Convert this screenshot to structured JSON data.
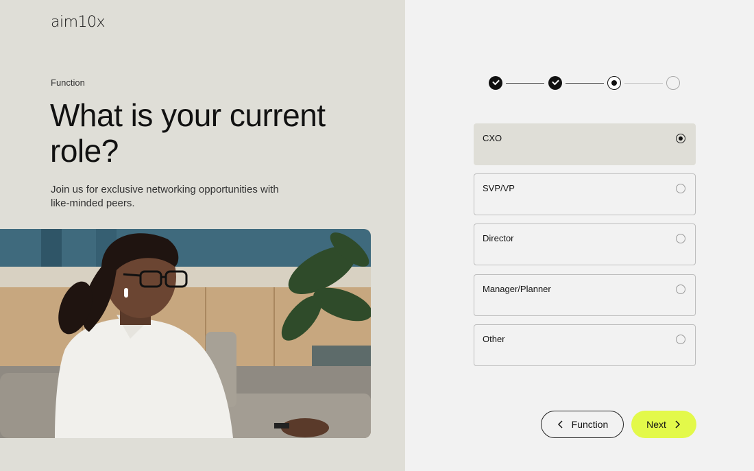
{
  "brand": {
    "logo": "aim10x"
  },
  "hero": {
    "eyebrow": "Function",
    "headline": "What is your current role?",
    "subtext": "Join us for exclusive networking opportunities with like-minded peers."
  },
  "stepper": {
    "steps": [
      "done",
      "done",
      "current",
      "todo"
    ]
  },
  "options": [
    {
      "label": "CXO",
      "selected": true
    },
    {
      "label": "SVP/VP",
      "selected": false
    },
    {
      "label": "Director",
      "selected": false
    },
    {
      "label": "Manager/Planner",
      "selected": false
    },
    {
      "label": "Other",
      "selected": false
    }
  ],
  "nav": {
    "back_label": "Function",
    "next_label": "Next"
  },
  "colors": {
    "left_panel_bg": "#dfded7",
    "right_panel_bg": "#f2f2f2",
    "accent": "#e3f94a",
    "selected_option_bg": "#dfded7"
  }
}
